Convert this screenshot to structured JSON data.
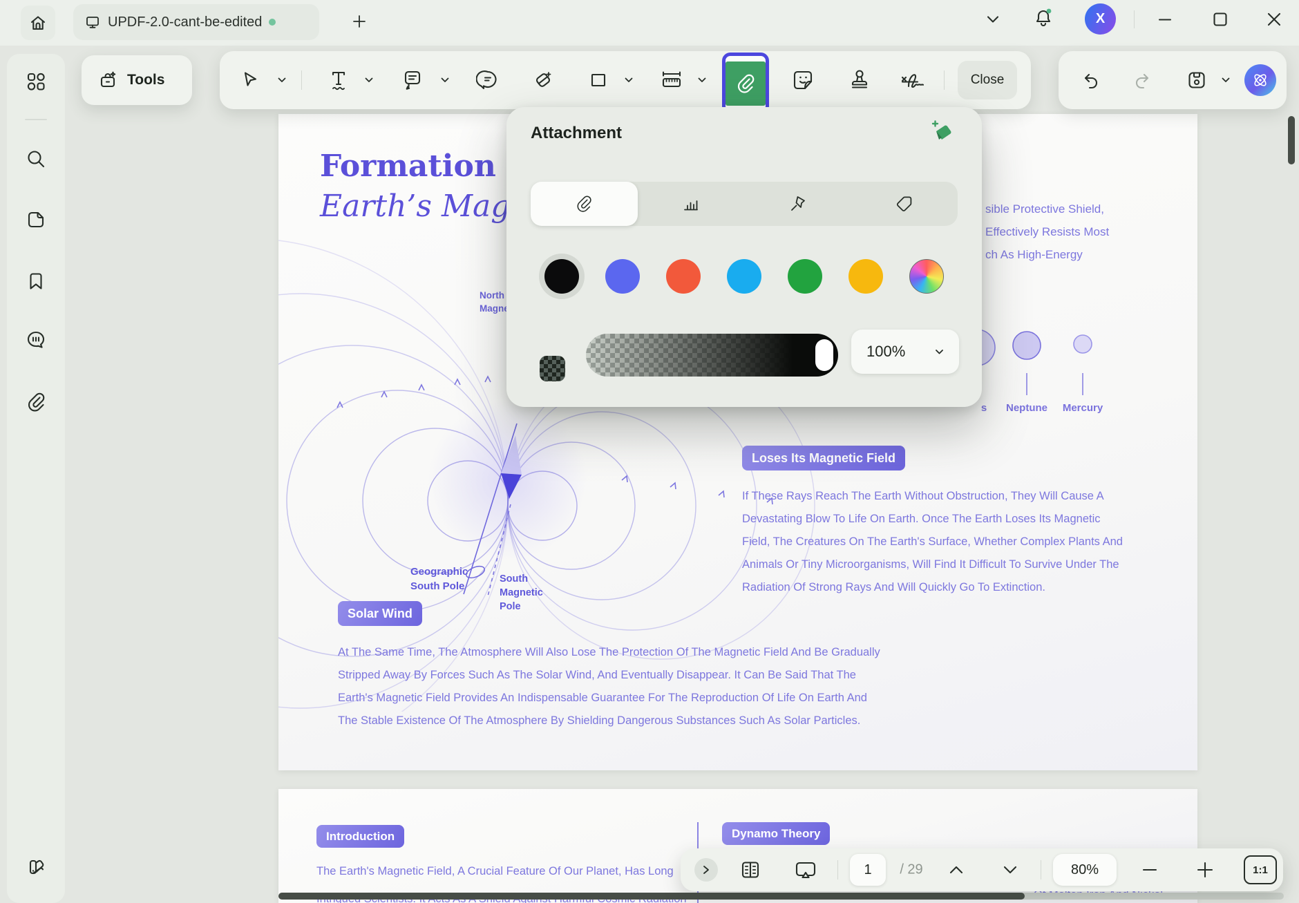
{
  "titlebar": {
    "tab_title": "UPDF-2.0-cant-be-edited",
    "avatar_initial": "X"
  },
  "toolbar": {
    "tools_label": "Tools",
    "close_label": "Close"
  },
  "popup": {
    "title": "Attachment",
    "opacity_value": "100%",
    "tabs": [
      "attachment",
      "chart",
      "pin",
      "tag"
    ],
    "swatches": [
      {
        "name": "black",
        "color": "#0b0b0c",
        "selected": true
      },
      {
        "name": "blue",
        "color": "#5b67ef"
      },
      {
        "name": "red",
        "color": "#f2593b"
      },
      {
        "name": "cyan",
        "color": "#19acef"
      },
      {
        "name": "green",
        "color": "#22a33f"
      },
      {
        "name": "yellow",
        "color": "#f7b80e"
      },
      {
        "name": "rainbow",
        "color": "rainbow"
      }
    ]
  },
  "page1": {
    "heading_line1": "Formation O",
    "heading_line2": "Earth’s Mag",
    "north_label_lines": [
      "North",
      "Magne"
    ],
    "geo_south_lines": [
      "Geographic",
      "South Pole"
    ],
    "south_magnetic_lines": [
      "South",
      "Magnetic",
      "Pole"
    ],
    "right_text_lines": [
      "sible Protective Shield,",
      "Effectively Resists Most",
      "ch As High-Energy"
    ],
    "loses_badge": "Loses Its Magnetic Field",
    "loses_lines": [
      "If These Rays Reach The Earth Without Obstruction, They Will Cause A",
      "Devastating Blow To Life On Earth. Once The Earth Loses Its Magnetic",
      "Field, The Creatures On The Earth's Surface, Whether Complex Plants And",
      "Animals Or Tiny Microorganisms, Will Find It Difficult To Survive Under The",
      "Radiation Of Strong Rays And Will Quickly Go To Extinction."
    ],
    "solar_badge": "Solar Wind",
    "solar_lines": [
      "At The Same Time, The Atmosphere Will Also Lose The Protection Of The Magnetic Field And Be Gradually",
      "Stripped Away By Forces Such As The Solar Wind, And Eventually Disappear. It Can Be Said That The",
      "Earth's Magnetic Field Provides An Indispensable Guarantee For The Reproduction Of Life On Earth And",
      "The Stable Existence Of The Atmosphere By Shielding Dangerous Substances Such As Solar Particles."
    ],
    "planets": {
      "cut": "s",
      "neptune": "Neptune",
      "mercury": "Mercury"
    }
  },
  "page2": {
    "intro_badge": "Introduction",
    "intro_line1": "The Earth's Magnetic Field, A Crucial Feature Of Our Planet, Has Long",
    "intro_line2": "Intrigued Scientists. It Acts As A Shield Against Harmful Cosmic Radiation",
    "dynamo_badge": "Dynamo Theory",
    "dynamo_fragment": "Of Molten Iron And Nickel"
  },
  "bottombar": {
    "page_current": "1",
    "page_total": "/ 29",
    "zoom_value": "80%",
    "fit_label": "1:1"
  },
  "colors": {
    "accent_purple": "#4c47de",
    "tool_green": "#3e9f63",
    "heading_purple": "#5b50d9",
    "body_purple": "#7d77de"
  }
}
